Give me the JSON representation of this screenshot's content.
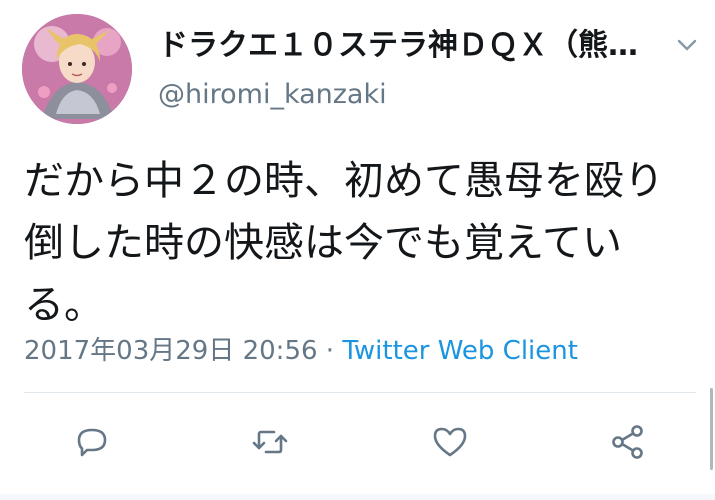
{
  "tweet": {
    "author": {
      "display_name": "ドラクエ１０ステラ神ＤＱＸ（熊…",
      "handle": "@hiromi_kanzaki"
    },
    "text": "だから中２の時、初めて愚母を殴り倒した時の快感は今でも覚えている。",
    "timestamp": "2017年03月29日 20:56",
    "separator": " · ",
    "client": "Twitter Web Client"
  },
  "icons": {
    "menu": "chevron-down-icon",
    "reply": "reply-icon",
    "retweet": "retweet-icon",
    "like": "heart-icon",
    "share": "share-icon"
  },
  "colors": {
    "text": "#14171a",
    "secondary": "#657786",
    "link": "#1b95e0",
    "icon": "#657786",
    "divider": "#e1e8ed"
  }
}
